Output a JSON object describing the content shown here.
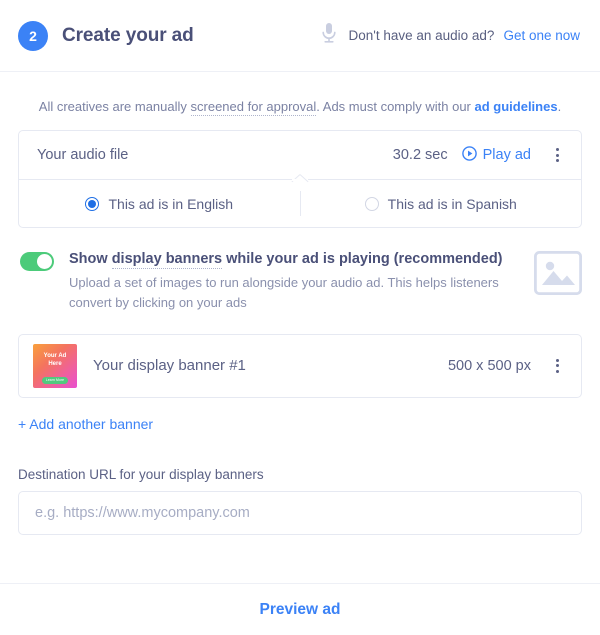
{
  "header": {
    "step_number": "2",
    "title": "Create your ad",
    "mic_icon": "microphone-icon",
    "prompt": "Don't have an audio ad?",
    "link_label": "Get one now"
  },
  "notice": {
    "part1": "All creatives are manually ",
    "tooltip_term": "screened for approval",
    "part2": ". Ads must comply with our ",
    "link_label": "ad guidelines",
    "part3": "."
  },
  "audio": {
    "file_label": "Your audio file",
    "duration": "30.2 sec",
    "play_label": "Play ad",
    "play_icon": "play-circle-icon",
    "menu_icon": "kebab-menu-icon"
  },
  "language": {
    "options": [
      {
        "label": "This ad is in English",
        "selected": true
      },
      {
        "label": "This ad is in Spanish",
        "selected": false
      }
    ]
  },
  "banners_toggle": {
    "enabled": true,
    "title_part1": "Show ",
    "title_tooltip_term": "display banners",
    "title_part2": " while your ad is playing (recommended)",
    "description": "Upload a set of images to run alongside your audio ad. This helps listeners convert by clicking on your ads",
    "placeholder_icon": "image-placeholder-icon"
  },
  "banner_item": {
    "thumb_line1": "Your Ad",
    "thumb_line2": "Here",
    "thumb_cta": "Learn More",
    "name": "Your display banner #1",
    "size": "500 x 500 px",
    "menu_icon": "kebab-menu-icon"
  },
  "add_banner_label": "+ Add another banner",
  "destination_url": {
    "label": "Destination URL for your display banners",
    "placeholder": "e.g. https://www.mycompany.com",
    "value": ""
  },
  "footer": {
    "preview_label": "Preview ad"
  },
  "colors": {
    "accent_blue": "#3b82f6",
    "toggle_green": "#4ccb7a",
    "text_dark": "#4a5078",
    "text_body": "#5b6185",
    "text_muted": "#8a90ad",
    "border": "#e6e9f2"
  }
}
